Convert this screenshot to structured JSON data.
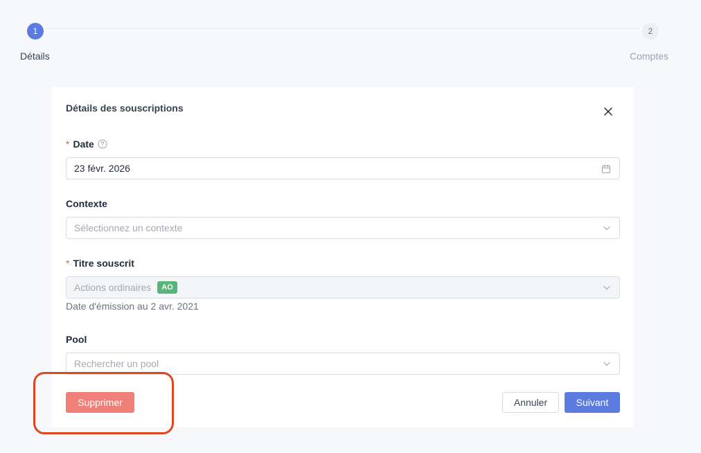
{
  "stepper": {
    "steps": [
      {
        "number": "1",
        "label": "Détails"
      },
      {
        "number": "2",
        "label": "Comptes"
      }
    ]
  },
  "modal": {
    "title": "Détails des souscriptions",
    "close_icon": "close-icon",
    "fields": {
      "date": {
        "label": "Date",
        "required": "*",
        "value": "23 févr. 2026",
        "icon": "calendar-icon"
      },
      "contexte": {
        "label": "Contexte",
        "placeholder": "Sélectionnez un contexte"
      },
      "titre": {
        "label": "Titre souscrit",
        "required": "*",
        "value": "Actions ordinaires",
        "tag": "AO",
        "hint": "Date d'émission au 2 avr. 2021"
      },
      "pool": {
        "label": "Pool",
        "placeholder": "Rechercher un pool"
      }
    },
    "buttons": {
      "delete": "Supprimer",
      "cancel": "Annuler",
      "next": "Suivant"
    }
  },
  "colors": {
    "primary": "#5b7be0",
    "danger": "#f07f7a",
    "tag_green": "#58b47a",
    "annotation": "#e0461f"
  }
}
